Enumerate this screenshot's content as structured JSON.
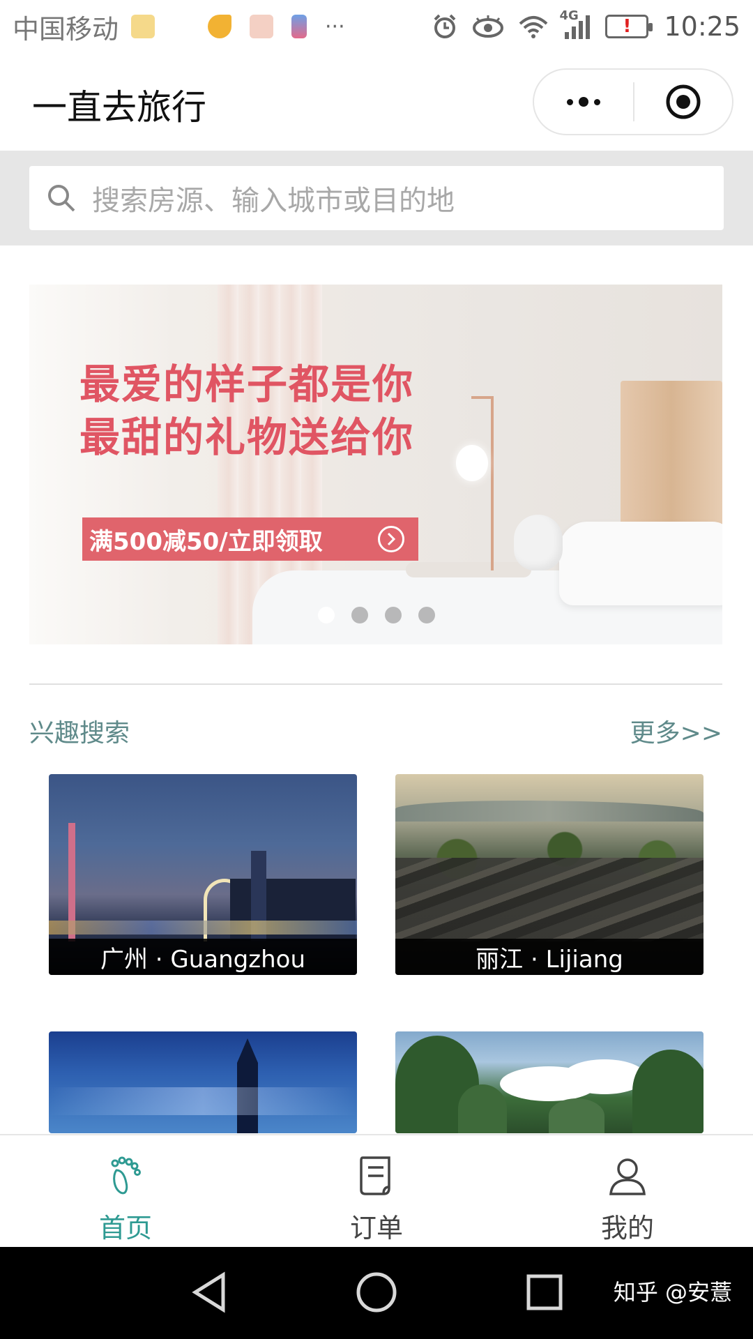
{
  "status_bar": {
    "carrier": "中国移动",
    "network": "4G",
    "time": "10:25",
    "battery_alert": "!",
    "overflow": "···"
  },
  "title_bar": {
    "title": "一直去旅行"
  },
  "search": {
    "placeholder": "搜索房源、输入城市或目的地"
  },
  "banner": {
    "line1": "最爱的样子都是你",
    "line2": "最甜的礼物送给你",
    "cta": "满500减50/立即领取",
    "slide_count": 4,
    "active_slide": 1
  },
  "interest": {
    "title": "兴趣搜索",
    "more": "更多>>",
    "cities": [
      {
        "label": "广州 · Guangzhou"
      },
      {
        "label": "丽江 · Lijiang"
      }
    ]
  },
  "tabbar": {
    "tabs": [
      {
        "label": "首页",
        "icon": "footprint-icon",
        "active": true
      },
      {
        "label": "订单",
        "icon": "order-icon",
        "active": false
      },
      {
        "label": "我的",
        "icon": "user-icon",
        "active": false
      }
    ]
  },
  "watermark": "知乎 @安薏",
  "colors": {
    "accent": "#2e9a92",
    "promo_red": "#e05563",
    "section_text": "#5f8a8a"
  }
}
